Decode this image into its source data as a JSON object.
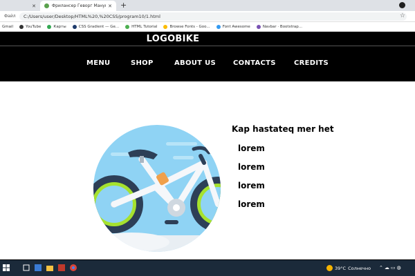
{
  "browser": {
    "tabs": [
      {
        "title": "",
        "active": false
      },
      {
        "title": "Фрилансер Геворг Мануки gev...",
        "active": true
      }
    ],
    "new_tab_label": "+",
    "address_info": "Файл",
    "address_url": "C:/Users/user/Desktop/HTML%20,%20CSS/program10/1.html",
    "bookmarks": [
      {
        "label": "Gmail",
        "icon_color": "#ffffff"
      },
      {
        "label": "YouTube",
        "icon_color": "#333333"
      },
      {
        "label": "Карты",
        "icon_color": "#34a853"
      },
      {
        "label": "CSS Gradient — Ge...",
        "icon_color": "#1e3a6b"
      },
      {
        "label": "HTML Tutorial",
        "icon_color": "#4caf50"
      },
      {
        "label": "Browse Fonts - Goo...",
        "icon_color": "#fbbc05"
      },
      {
        "label": "Font Awesome",
        "icon_color": "#339af0"
      },
      {
        "label": "Navbar · Bootstrap...",
        "icon_color": "#7952b3"
      }
    ]
  },
  "site": {
    "logo": "LOGOBIKE",
    "nav": [
      "MENU",
      "SHOP",
      "ABOUT US",
      "CONTACTS",
      "CREDITS"
    ],
    "content_title": "Kap hastateq mer het",
    "list": [
      "lorem",
      "lorem",
      "lorem",
      "lorem"
    ],
    "colors": {
      "header_bg": "#000000",
      "header_text": "#ffffff",
      "art_circle": "#8fd3f4",
      "art_tire": "#2d3f57",
      "art_wheel_accent": "#a6e22e"
    }
  },
  "taskbar": {
    "weather_temp": "39°C",
    "weather_text": "Солнечно"
  }
}
